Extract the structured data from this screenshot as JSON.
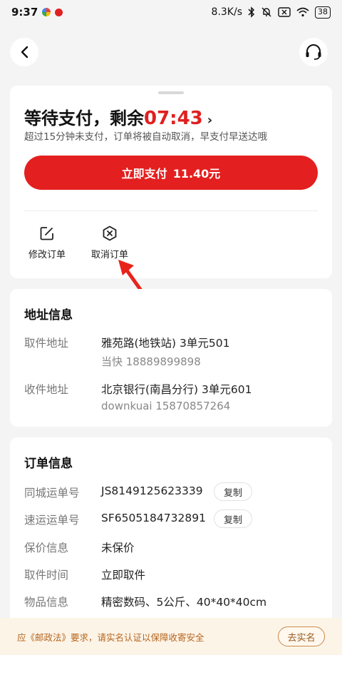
{
  "status_bar": {
    "time": "9:37",
    "net_speed": "8.3K/s",
    "battery": "38",
    "icons": [
      "app-dot-icon",
      "app-dot-icon",
      "bluetooth-icon",
      "mute-icon",
      "sim-x-icon",
      "wifi-icon",
      "battery-icon"
    ]
  },
  "nav": {
    "back_icon": "chevron-left-icon",
    "service_icon": "headset-icon"
  },
  "payment": {
    "title": "等待支付，剩余",
    "countdown": "07:43",
    "subtitle": "超过15分钟未支付，订单将被自动取消，早支付早送达哦",
    "pay_label": "立即支付",
    "pay_amount": "11.40元",
    "actions": [
      {
        "label": "修改订单",
        "icon": "edit-icon"
      },
      {
        "label": "取消订单",
        "icon": "cancel-hex-icon"
      }
    ],
    "accent_color": "#e41f1f"
  },
  "address": {
    "title": "地址信息",
    "pickup_label": "取件地址",
    "pickup_address": "雅苑路(地铁站) 3单元501",
    "pickup_contact": "当快 18889899898",
    "delivery_label": "收件地址",
    "delivery_address": "北京银行(南昌分行) 3单元601",
    "delivery_contact": "downkuai 15870857264"
  },
  "order": {
    "title": "订单信息",
    "rows": [
      {
        "label": "同城运单号",
        "value": "JS8149125623339",
        "copy": "复制"
      },
      {
        "label": "速运运单号",
        "value": "SF6505184732891",
        "copy": "复制"
      },
      {
        "label": "保价信息",
        "value": "未保价"
      },
      {
        "label": "取件时间",
        "value": "立即取件"
      },
      {
        "label": "物品信息",
        "value": "精密数码、5公斤、40*40*40cm"
      }
    ]
  },
  "notice": {
    "text": "应《邮政法》要求，请实名认证以保障收寄安全",
    "button": "去实名",
    "color": "#b5651d"
  }
}
